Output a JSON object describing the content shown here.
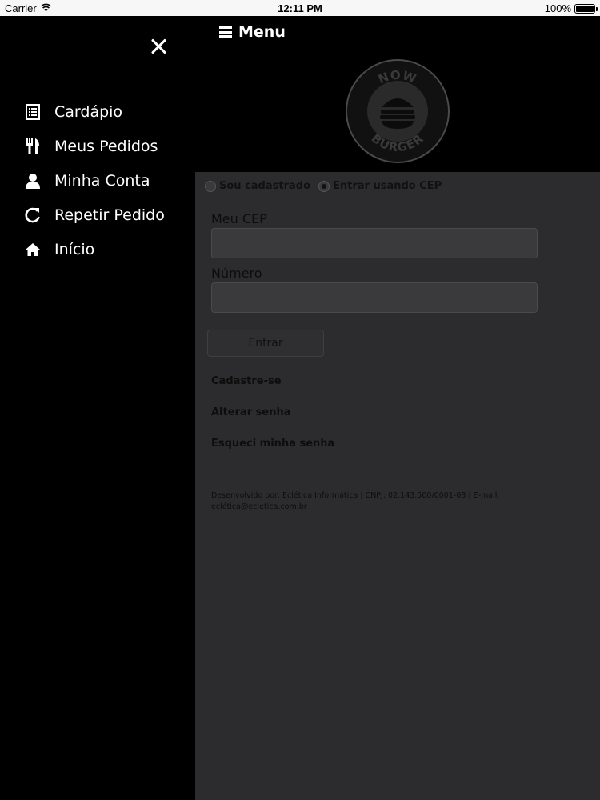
{
  "status_bar": {
    "carrier": "Carrier",
    "time": "12:11 PM",
    "battery": "100%",
    "battery_level": 1.0
  },
  "header": {
    "menu_label": "Menu"
  },
  "logo": {
    "top_text": "NOW",
    "bottom_text": "BURGER"
  },
  "side_menu": {
    "items": [
      {
        "label": "Cardápio",
        "icon": "menu-list-icon"
      },
      {
        "label": "Meus Pedidos",
        "icon": "fork-knife-icon"
      },
      {
        "label": "Minha Conta",
        "icon": "user-icon"
      },
      {
        "label": "Repetir Pedido",
        "icon": "refresh-icon"
      },
      {
        "label": "Início",
        "icon": "home-icon"
      }
    ]
  },
  "login": {
    "radio_registered": "Sou cadastrado",
    "radio_cep": "Entrar usando CEP",
    "selected": "cep",
    "cep_label": "Meu CEP",
    "cep_value": "",
    "number_label": "Número",
    "number_value": "",
    "submit_label": "Entrar",
    "link_register": "Cadastre-se",
    "link_change_password": "Alterar senha",
    "link_forgot_password": "Esqueci minha senha",
    "footer": "Desenvolvido por: Eclética Informática | CNPJ: 02.143.500/0001-08 | E-mail: eclética@ecletica.com.br"
  }
}
